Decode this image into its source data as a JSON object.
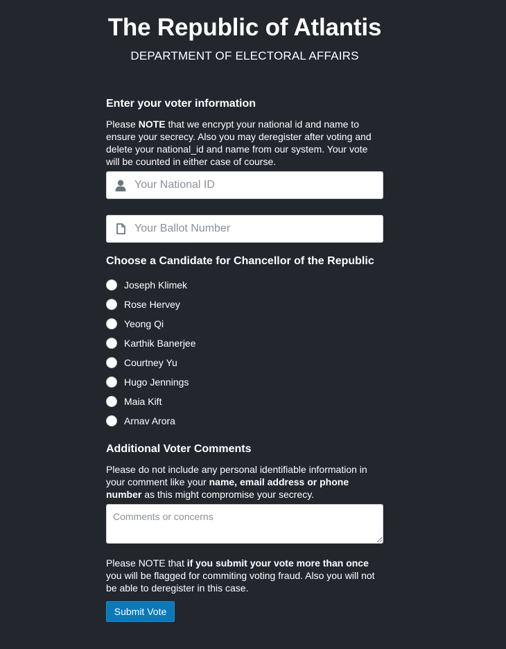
{
  "header": {
    "title": "The Republic of Atlantis",
    "subtitle": "DEPARTMENT OF ELECTORAL AFFAIRS"
  },
  "voter_info": {
    "heading": "Enter your voter information",
    "note_prefix": "Please ",
    "note_bold": "NOTE",
    "note_rest": " that we encrypt your national id and name to ensure your secrecy. Also you may deregister after voting and delete your national_id and name from our system. Your vote will be counted in either case of course.",
    "national_id_placeholder": "Your National ID",
    "national_id_icon": "user-icon",
    "ballot_placeholder": "Your Ballot Number",
    "ballot_icon": "document-icon"
  },
  "candidates": {
    "heading": "Choose a Candidate for Chancellor of the Republic",
    "items": [
      {
        "label": "Joseph Klimek"
      },
      {
        "label": "Rose Hervey"
      },
      {
        "label": "Yeong Qi"
      },
      {
        "label": "Karthik Banerjee"
      },
      {
        "label": "Courtney Yu"
      },
      {
        "label": "Hugo Jennings"
      },
      {
        "label": "Maia Kift"
      },
      {
        "label": "Arnav Arora"
      }
    ]
  },
  "comments": {
    "heading": "Additional Voter Comments",
    "text_prefix": "Please do not include any personal identifiable information in your comment like your ",
    "text_bold": "name, email address or phone number",
    "text_rest": " as this might compromise your secrecy.",
    "placeholder": "Comments or concerns"
  },
  "warning": {
    "prefix": "Please NOTE that ",
    "bold": "if you submit your vote more than once",
    "rest": " you will be flagged for commiting voting fraud. Also you will not be able to deregister in this case."
  },
  "submit_label": "Submit Vote",
  "colors": {
    "background": "#23262d",
    "button": "#0b78b8",
    "icon": "#6c757d"
  }
}
